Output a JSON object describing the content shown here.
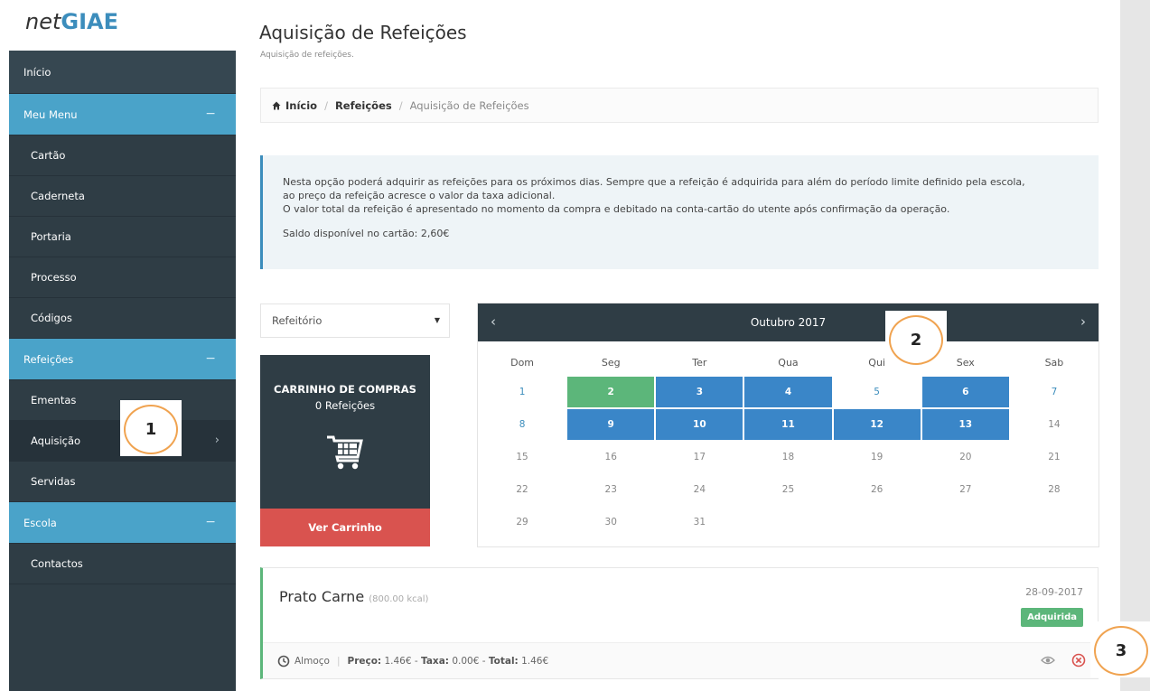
{
  "logo": {
    "net": "net",
    "giae": "GIAE"
  },
  "sidebar": {
    "items": [
      {
        "label": "Início"
      },
      {
        "label": "Meu Menu"
      },
      {
        "label": "Cartão"
      },
      {
        "label": "Caderneta"
      },
      {
        "label": "Portaria"
      },
      {
        "label": "Processo"
      },
      {
        "label": "Códigos"
      },
      {
        "label": "Refeições"
      },
      {
        "label": "Ementas"
      },
      {
        "label": "Aquisição"
      },
      {
        "label": "Servidas"
      },
      {
        "label": "Escola"
      },
      {
        "label": "Contactos"
      }
    ],
    "group_toggle": "−",
    "chevron": "›"
  },
  "header": {
    "title": "Aquisição de Refeições",
    "subtitle": "Aquisição de refeições."
  },
  "breadcrumb": {
    "items": [
      "Início",
      "Refeições",
      "Aquisição de Refeições"
    ],
    "separator": "/"
  },
  "info": {
    "line1": "Nesta opção poderá adquirir as refeições para os próximos dias. Sempre que a refeição é adquirida para além do período limite definido pela escola,",
    "line2": "ao preço da refeição acresce o valor da taxa adicional.",
    "line3": "O valor total da refeição é apresentado no momento da compra e debitado na conta-cartão do utente após confirmação da operação.",
    "saldo": "Saldo disponível no cartão: 2,60€"
  },
  "location_select": {
    "value": "Refeitório",
    "caret": "▼"
  },
  "cart": {
    "title": "CARRINHO DE COMPRAS",
    "count": "0 Refeições",
    "button": "Ver Carrinho"
  },
  "calendar": {
    "month": "Outubro 2017",
    "prev": "‹",
    "next": "›",
    "weekdays": [
      "Dom",
      "Seg",
      "Ter",
      "Qua",
      "Qui",
      "Sex",
      "Sab"
    ],
    "weeks": [
      [
        {
          "d": "1",
          "s": "avail"
        },
        {
          "d": "2",
          "s": "green"
        },
        {
          "d": "3",
          "s": "blue"
        },
        {
          "d": "4",
          "s": "blue"
        },
        {
          "d": "5",
          "s": "avail"
        },
        {
          "d": "6",
          "s": "blue"
        },
        {
          "d": "7",
          "s": "avail"
        }
      ],
      [
        {
          "d": "8",
          "s": "avail"
        },
        {
          "d": "9",
          "s": "blue"
        },
        {
          "d": "10",
          "s": "blue"
        },
        {
          "d": "11",
          "s": "blue"
        },
        {
          "d": "12",
          "s": "blue"
        },
        {
          "d": "13",
          "s": "blue"
        },
        {
          "d": "14",
          "s": "none"
        }
      ],
      [
        {
          "d": "15",
          "s": "none"
        },
        {
          "d": "16",
          "s": "none"
        },
        {
          "d": "17",
          "s": "none"
        },
        {
          "d": "18",
          "s": "none"
        },
        {
          "d": "19",
          "s": "none"
        },
        {
          "d": "20",
          "s": "none"
        },
        {
          "d": "21",
          "s": "none"
        }
      ],
      [
        {
          "d": "22",
          "s": "none"
        },
        {
          "d": "23",
          "s": "none"
        },
        {
          "d": "24",
          "s": "none"
        },
        {
          "d": "25",
          "s": "none"
        },
        {
          "d": "26",
          "s": "none"
        },
        {
          "d": "27",
          "s": "none"
        },
        {
          "d": "28",
          "s": "none"
        }
      ],
      [
        {
          "d": "29",
          "s": "none"
        },
        {
          "d": "30",
          "s": "none"
        },
        {
          "d": "31",
          "s": "none"
        },
        {
          "d": "",
          "s": "empty"
        },
        {
          "d": "",
          "s": "empty"
        },
        {
          "d": "",
          "s": "empty"
        },
        {
          "d": "",
          "s": "empty"
        }
      ]
    ]
  },
  "meal": {
    "name": "Prato Carne",
    "kcal": "(800.00 kcal)",
    "date": "28-09-2017",
    "status": "Adquirida",
    "type": "Almoço",
    "price_label": "Preço:",
    "price": "1.46€",
    "tax_label": "Taxa:",
    "tax": "0.00€",
    "total_label": "Total:",
    "total": "1.46€",
    "dash": "-"
  },
  "callouts": [
    "1",
    "2",
    "3"
  ],
  "colors": {
    "sidebar_bg": "#2f3d45",
    "sidebar_group": "#4aa3c9",
    "accent_blue": "#3a86c8",
    "selected_green": "#5cb67a",
    "cart_button_red": "#d9534f",
    "callout_ring": "#f0a350"
  }
}
